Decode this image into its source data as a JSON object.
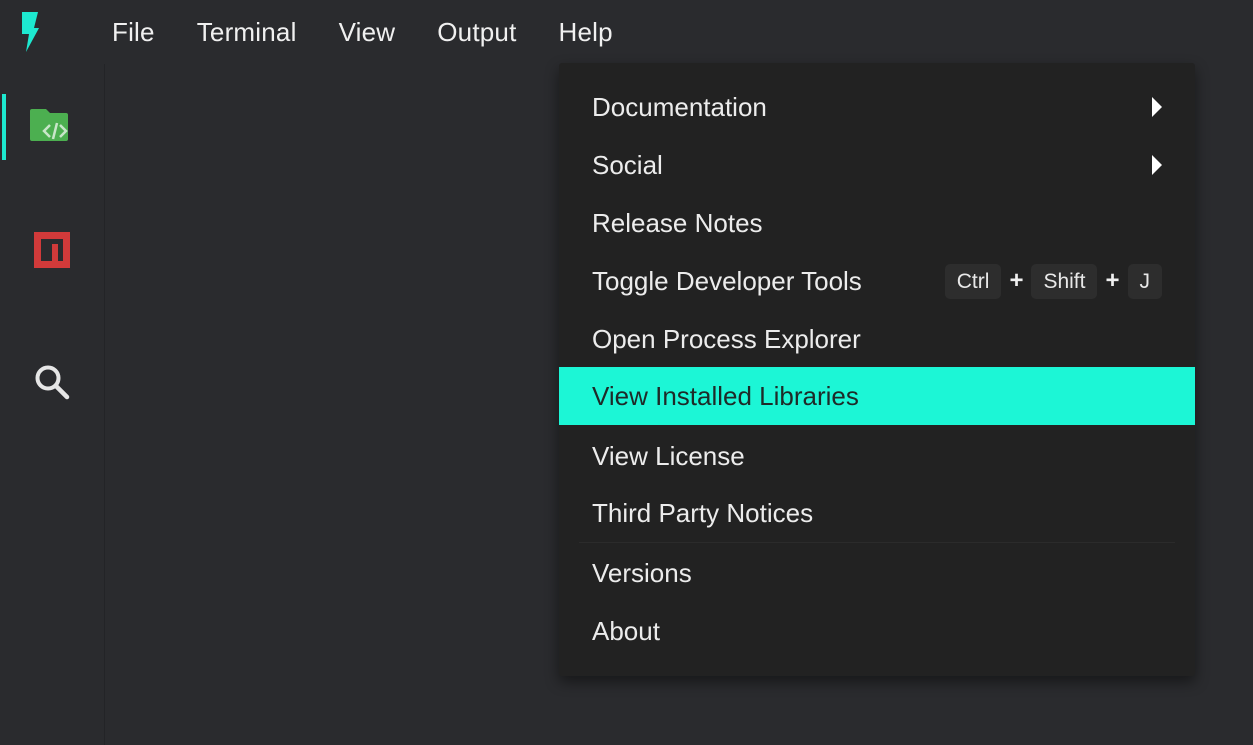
{
  "app": {
    "logo_icon": "lightning-bolt-icon",
    "accent_color": "#1de9d0",
    "highlight_color": "#1cf6d6"
  },
  "menubar": {
    "items": [
      {
        "label": "File"
      },
      {
        "label": "Terminal"
      },
      {
        "label": "View"
      },
      {
        "label": "Output"
      },
      {
        "label": "Help"
      }
    ]
  },
  "activitybar": {
    "items": [
      {
        "name": "explorer",
        "icon": "code-folder-icon",
        "active": true
      },
      {
        "name": "npm",
        "icon": "npm-icon",
        "active": false
      },
      {
        "name": "search",
        "icon": "search-icon",
        "active": false
      }
    ]
  },
  "help_menu": {
    "items": [
      {
        "label": "Documentation",
        "submenu": true
      },
      {
        "label": "Social",
        "submenu": true
      },
      {
        "label": "Release Notes"
      },
      {
        "label": "Toggle Developer Tools",
        "shortcut": [
          "Ctrl",
          "Shift",
          "J"
        ],
        "shortcut_separator": "+"
      },
      {
        "label": "Open Process Explorer"
      },
      {
        "label": "View Installed Libraries",
        "highlighted": true
      },
      {
        "label": "View License"
      },
      {
        "label": "Third Party Notices"
      },
      {
        "label": "Versions"
      },
      {
        "label": "About"
      }
    ]
  }
}
